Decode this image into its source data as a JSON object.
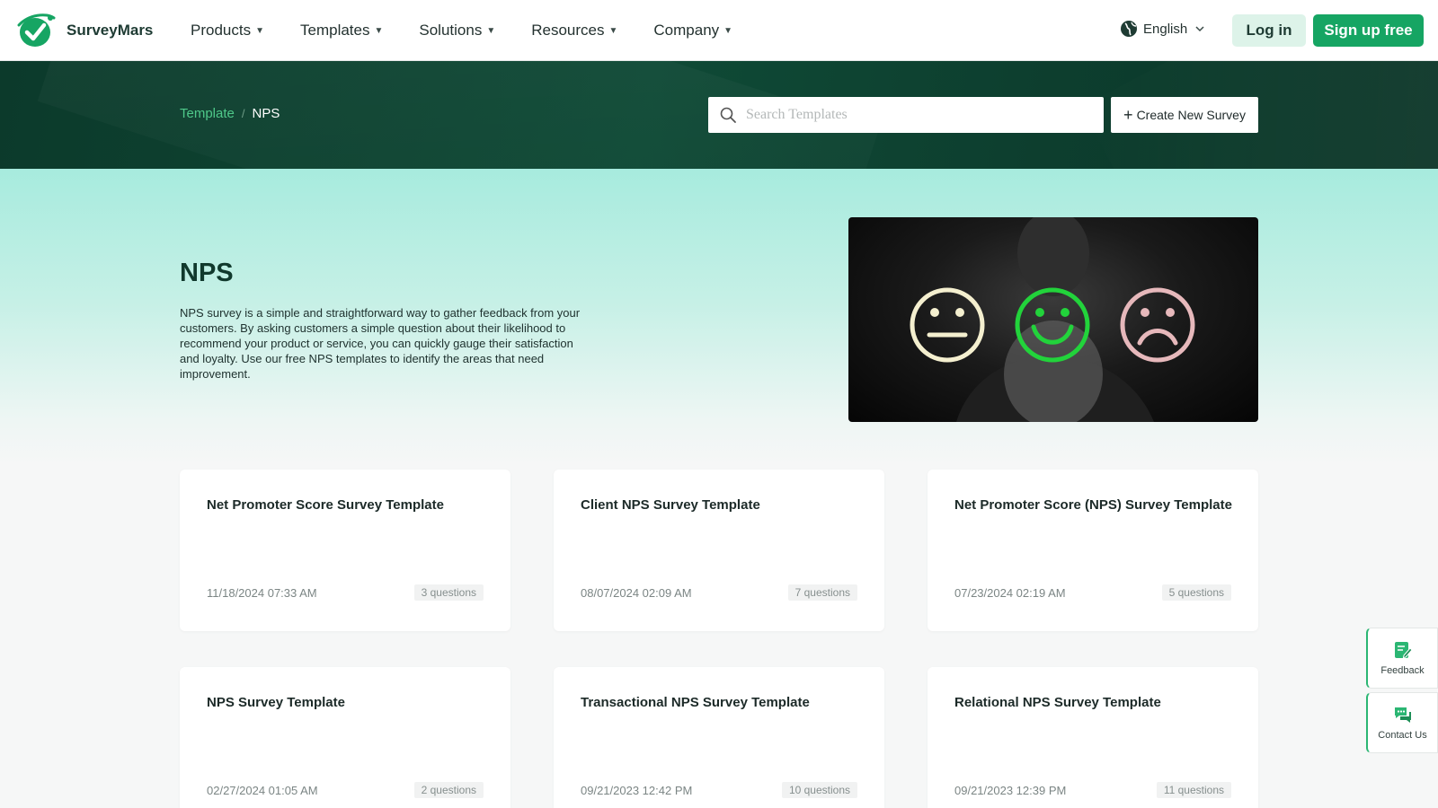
{
  "brand": {
    "name": "SurveyMars",
    "accent": "#16a563",
    "dark_green": "#0f4a36"
  },
  "nav": {
    "items": [
      {
        "label": "Products"
      },
      {
        "label": "Templates"
      },
      {
        "label": "Solutions"
      },
      {
        "label": "Resources"
      },
      {
        "label": "Company"
      }
    ],
    "language": "English",
    "login_label": "Log in",
    "signup_label": "Sign up free"
  },
  "banner": {
    "breadcrumb": {
      "parent": "Template",
      "separator": "/",
      "current": "NPS"
    },
    "search": {
      "placeholder": "Search Templates",
      "value": ""
    },
    "create_label": "Create New Survey"
  },
  "hero": {
    "title": "NPS",
    "description": "NPS survey is a simple and straightforward way to gather feedback from your customers. By asking customers a simple question about their likelihood to recommend your product or service, you can quickly gauge their satisfaction and loyalty. Use our free NPS templates to identify the areas that need improvement.",
    "image_icons": [
      "neutral-face-icon",
      "happy-face-icon",
      "sad-face-icon"
    ]
  },
  "templates": [
    {
      "title": "Net Promoter Score Survey Template",
      "date": "11/18/2024 07:33 AM",
      "questions": "3 questions"
    },
    {
      "title": "Client NPS Survey Template",
      "date": "08/07/2024 02:09 AM",
      "questions": "7 questions"
    },
    {
      "title": "Net Promoter Score (NPS) Survey Template",
      "date": "07/23/2024 02:19 AM",
      "questions": "5 questions"
    },
    {
      "title": "NPS Survey Template",
      "date": "02/27/2024 01:05 AM",
      "questions": "2 questions"
    },
    {
      "title": "Transactional NPS Survey Template",
      "date": "09/21/2023 12:42 PM",
      "questions": "10 questions"
    },
    {
      "title": "Relational NPS Survey Template",
      "date": "09/21/2023 12:39 PM",
      "questions": "11 questions"
    }
  ],
  "side_widgets": {
    "feedback_label": "Feedback",
    "contact_label": "Contact Us"
  }
}
